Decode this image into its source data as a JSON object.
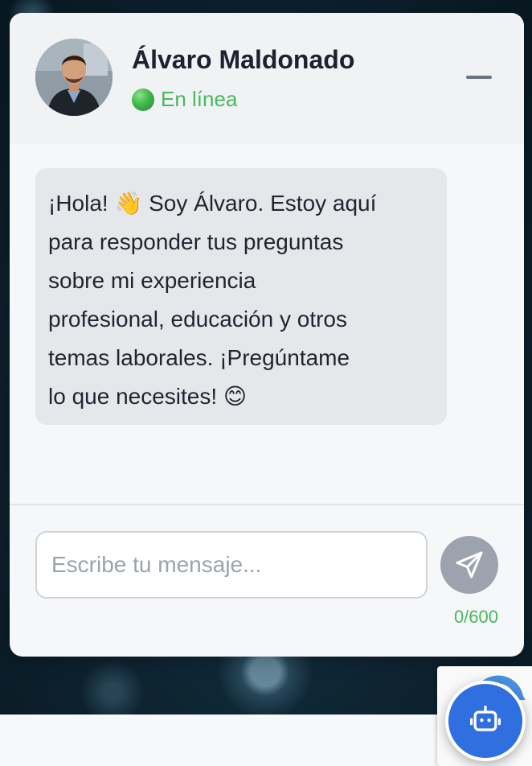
{
  "chat": {
    "contact_name": "Álvaro Maldonado",
    "status_text": "En línea",
    "welcome_message": "¡Hola! 👋 Soy Álvaro. Estoy aquí\npara responder tus preguntas\nsobre mi experiencia\nprofesional, educación y otros\ntemas laborales. ¡Pregúntame\nlo que necesites! 😊",
    "input_placeholder": "Escribe tu mensaje...",
    "input_value": "",
    "char_counter": "0/600"
  },
  "colors": {
    "online": "#49b85f",
    "send_button": "#9ca3af",
    "bot_launcher": "#2f6fe0",
    "bubble": "#e6e7eb"
  },
  "icons": {
    "minimize": "minimize-icon",
    "send": "send-icon",
    "bot": "bot-icon",
    "recaptcha": "recaptcha-icon"
  }
}
